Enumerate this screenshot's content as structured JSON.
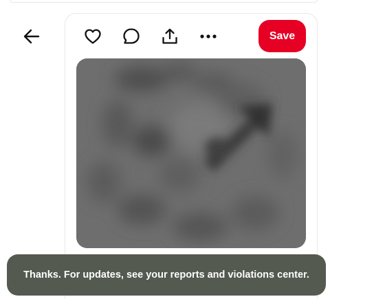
{
  "toolbar": {
    "back_icon": "arrow-left-icon",
    "like_icon": "heart-icon",
    "comment_icon": "comment-bubble-icon",
    "share_icon": "share-upload-icon",
    "more_icon": "more-horizontal-icon",
    "save_label": "Save"
  },
  "colors": {
    "save_button": "#e60023",
    "toast_background": "#545a4f"
  },
  "pin": {
    "image": "blurred-gray-image"
  },
  "toast": {
    "message": "Thanks. For updates, see your reports and violations center."
  }
}
